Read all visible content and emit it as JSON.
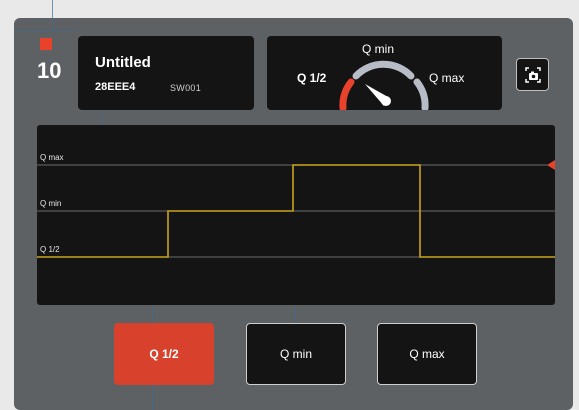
{
  "channel": {
    "number": "10"
  },
  "device": {
    "name": "Untitled",
    "serial": "28EEE4",
    "model": "SW001"
  },
  "gauge": {
    "label_min": "Q min",
    "label_half": "Q 1/2",
    "label_max": "Q max",
    "active": "Q 1/2",
    "colors": {
      "active_arc": "#e8412c",
      "arc": "#b8bcc6",
      "needle": "#ffffff"
    }
  },
  "graph": {
    "levels": {
      "max": "Q max",
      "min": "Q min",
      "half": "Q 1/2"
    },
    "trace_color": "#c9a31b",
    "marker_color": "#e8412c",
    "steps": [
      "Q 1/2",
      "Q min",
      "Q max",
      "Q 1/2"
    ]
  },
  "buttons": {
    "half": "Q 1/2",
    "min": "Q min",
    "max": "Q max",
    "active": "Q 1/2"
  },
  "icons": {
    "snapshot": "camera-snapshot-icon",
    "channel": "channel-indicator-square"
  }
}
